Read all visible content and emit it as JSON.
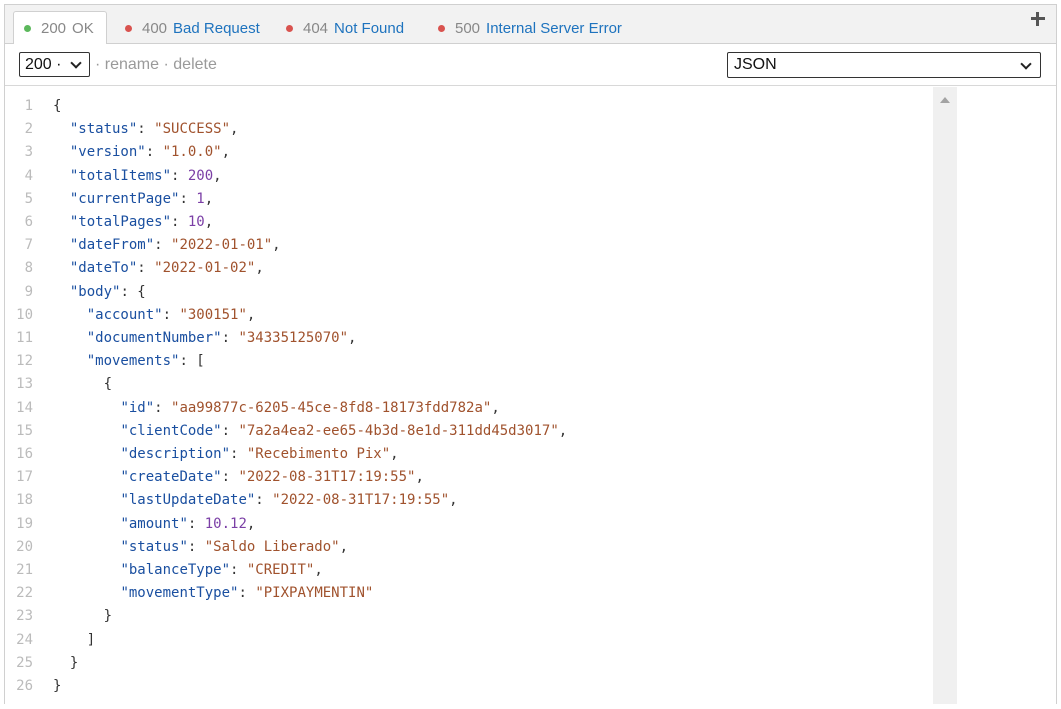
{
  "tabs": [
    {
      "code": "200",
      "label": "OK",
      "dot_color": "#5cb85c",
      "active": true
    },
    {
      "code": "400",
      "label": "Bad Request",
      "dot_color": "#d9534f",
      "active": false
    },
    {
      "code": "404",
      "label": "Not Found",
      "dot_color": "#d9534f",
      "active": false
    },
    {
      "code": "500",
      "label": "Internal Server Error",
      "dot_color": "#d9534f",
      "active": false
    }
  ],
  "add_icon": "plus-icon",
  "toolbar": {
    "status_select_value": "200 ·",
    "sep1": "·",
    "rename_label": "rename",
    "sep2": "·",
    "delete_label": "delete",
    "format_select_value": "JSON"
  },
  "code_lines": [
    [
      {
        "t": "p",
        "v": "{"
      }
    ],
    [
      {
        "t": "p",
        "v": "  "
      },
      {
        "t": "k",
        "v": "\"status\""
      },
      {
        "t": "p",
        "v": ": "
      },
      {
        "t": "s",
        "v": "\"SUCCESS\""
      },
      {
        "t": "p",
        "v": ","
      }
    ],
    [
      {
        "t": "p",
        "v": "  "
      },
      {
        "t": "k",
        "v": "\"version\""
      },
      {
        "t": "p",
        "v": ": "
      },
      {
        "t": "s",
        "v": "\"1.0.0\""
      },
      {
        "t": "p",
        "v": ","
      }
    ],
    [
      {
        "t": "p",
        "v": "  "
      },
      {
        "t": "k",
        "v": "\"totalItems\""
      },
      {
        "t": "p",
        "v": ": "
      },
      {
        "t": "n",
        "v": "200"
      },
      {
        "t": "p",
        "v": ","
      }
    ],
    [
      {
        "t": "p",
        "v": "  "
      },
      {
        "t": "k",
        "v": "\"currentPage\""
      },
      {
        "t": "p",
        "v": ": "
      },
      {
        "t": "n",
        "v": "1"
      },
      {
        "t": "p",
        "v": ","
      }
    ],
    [
      {
        "t": "p",
        "v": "  "
      },
      {
        "t": "k",
        "v": "\"totalPages\""
      },
      {
        "t": "p",
        "v": ": "
      },
      {
        "t": "n",
        "v": "10"
      },
      {
        "t": "p",
        "v": ","
      }
    ],
    [
      {
        "t": "p",
        "v": "  "
      },
      {
        "t": "k",
        "v": "\"dateFrom\""
      },
      {
        "t": "p",
        "v": ": "
      },
      {
        "t": "s",
        "v": "\"2022-01-01\""
      },
      {
        "t": "p",
        "v": ","
      }
    ],
    [
      {
        "t": "p",
        "v": "  "
      },
      {
        "t": "k",
        "v": "\"dateTo\""
      },
      {
        "t": "p",
        "v": ": "
      },
      {
        "t": "s",
        "v": "\"2022-01-02\""
      },
      {
        "t": "p",
        "v": ","
      }
    ],
    [
      {
        "t": "p",
        "v": "  "
      },
      {
        "t": "k",
        "v": "\"body\""
      },
      {
        "t": "p",
        "v": ": {"
      }
    ],
    [
      {
        "t": "p",
        "v": "    "
      },
      {
        "t": "k",
        "v": "\"account\""
      },
      {
        "t": "p",
        "v": ": "
      },
      {
        "t": "s",
        "v": "\"300151\""
      },
      {
        "t": "p",
        "v": ","
      }
    ],
    [
      {
        "t": "p",
        "v": "    "
      },
      {
        "t": "k",
        "v": "\"documentNumber\""
      },
      {
        "t": "p",
        "v": ": "
      },
      {
        "t": "s",
        "v": "\"34335125070\""
      },
      {
        "t": "p",
        "v": ","
      }
    ],
    [
      {
        "t": "p",
        "v": "    "
      },
      {
        "t": "k",
        "v": "\"movements\""
      },
      {
        "t": "p",
        "v": ": ["
      }
    ],
    [
      {
        "t": "p",
        "v": "      {"
      }
    ],
    [
      {
        "t": "p",
        "v": "        "
      },
      {
        "t": "k",
        "v": "\"id\""
      },
      {
        "t": "p",
        "v": ": "
      },
      {
        "t": "s",
        "v": "\"aa99877c-6205-45ce-8fd8-18173fdd782a\""
      },
      {
        "t": "p",
        "v": ","
      }
    ],
    [
      {
        "t": "p",
        "v": "        "
      },
      {
        "t": "k",
        "v": "\"clientCode\""
      },
      {
        "t": "p",
        "v": ": "
      },
      {
        "t": "s",
        "v": "\"7a2a4ea2-ee65-4b3d-8e1d-311dd45d3017\""
      },
      {
        "t": "p",
        "v": ","
      }
    ],
    [
      {
        "t": "p",
        "v": "        "
      },
      {
        "t": "k",
        "v": "\"description\""
      },
      {
        "t": "p",
        "v": ": "
      },
      {
        "t": "s",
        "v": "\"Recebimento Pix\""
      },
      {
        "t": "p",
        "v": ","
      }
    ],
    [
      {
        "t": "p",
        "v": "        "
      },
      {
        "t": "k",
        "v": "\"createDate\""
      },
      {
        "t": "p",
        "v": ": "
      },
      {
        "t": "s",
        "v": "\"2022-08-31T17:19:55\""
      },
      {
        "t": "p",
        "v": ","
      }
    ],
    [
      {
        "t": "p",
        "v": "        "
      },
      {
        "t": "k",
        "v": "\"lastUpdateDate\""
      },
      {
        "t": "p",
        "v": ": "
      },
      {
        "t": "s",
        "v": "\"2022-08-31T17:19:55\""
      },
      {
        "t": "p",
        "v": ","
      }
    ],
    [
      {
        "t": "p",
        "v": "        "
      },
      {
        "t": "k",
        "v": "\"amount\""
      },
      {
        "t": "p",
        "v": ": "
      },
      {
        "t": "n",
        "v": "10.12"
      },
      {
        "t": "p",
        "v": ","
      }
    ],
    [
      {
        "t": "p",
        "v": "        "
      },
      {
        "t": "k",
        "v": "\"status\""
      },
      {
        "t": "p",
        "v": ": "
      },
      {
        "t": "s",
        "v": "\"Saldo Liberado\""
      },
      {
        "t": "p",
        "v": ","
      }
    ],
    [
      {
        "t": "p",
        "v": "        "
      },
      {
        "t": "k",
        "v": "\"balanceType\""
      },
      {
        "t": "p",
        "v": ": "
      },
      {
        "t": "s",
        "v": "\"CREDIT\""
      },
      {
        "t": "p",
        "v": ","
      }
    ],
    [
      {
        "t": "p",
        "v": "        "
      },
      {
        "t": "k",
        "v": "\"movementType\""
      },
      {
        "t": "p",
        "v": ": "
      },
      {
        "t": "s",
        "v": "\"PIXPAYMENTIN\""
      }
    ],
    [
      {
        "t": "p",
        "v": "      }"
      }
    ],
    [
      {
        "t": "p",
        "v": "    ]"
      }
    ],
    [
      {
        "t": "p",
        "v": "  }"
      }
    ],
    [
      {
        "t": "p",
        "v": "}"
      }
    ]
  ],
  "colors": {
    "key": "#1a4fa0",
    "string": "#a0522d",
    "number": "#7b3fa6",
    "link": "#1e73be"
  }
}
